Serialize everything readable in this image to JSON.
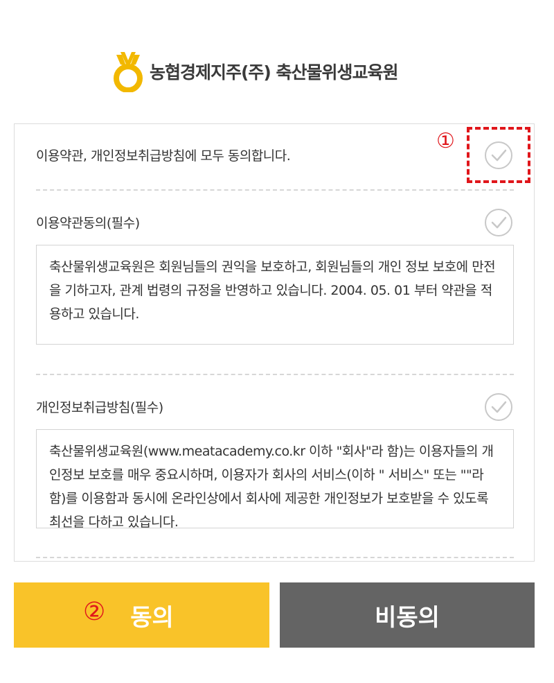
{
  "header": {
    "brand": "농협경제지주(주) 축산물위생교육원"
  },
  "agree_all": {
    "label": "이용약관, 개인정보취급방침에 모두 동의합니다.",
    "marker": "①"
  },
  "terms": {
    "title": "이용약관동의(필수)",
    "body": "축산물위생교육원은 회원님들의 권익을 보호하고, 회원님들의 개인 정보 보호에 만전을 기하고자, 관계 법령의 규정을 반영하고 있습니다. 2004. 05. 01 부터 약관을 적용하고 있습니다."
  },
  "privacy": {
    "title": "개인정보취급방침(필수)",
    "body": "축산물위생교육원(www.meatacademy.co.kr 이하 \"회사\"라 함)는 이용자들의 개인정보 보호를 매우 중요시하며, 이용자가 회사의 서비스(이하 \" 서비스\" 또는 \"\"라 함)를 이용함과 동시에 온라인상에서 회사에 제공한 개인정보가 보호받을 수 있도록 최선을 다하고 있습니다."
  },
  "buttons": {
    "agree_marker": "②",
    "agree": "동의",
    "disagree": "비동의"
  },
  "colors": {
    "agree_bg": "#f9c329",
    "disagree_bg": "#646464",
    "marker": "#e0161b",
    "check": "#c8c8c8"
  },
  "icons": {
    "logo": "nonghyup-logo-icon",
    "check": "check-circle-icon"
  }
}
